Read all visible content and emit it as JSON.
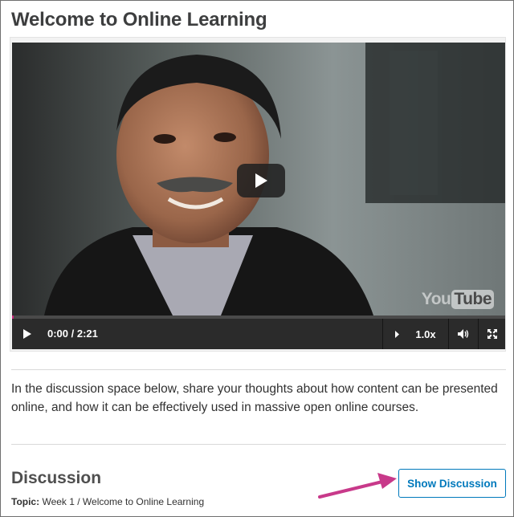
{
  "unit": {
    "title": "Welcome to Online Learning",
    "intro_text": "In the discussion space below, share your thoughts about how content can be presented online, and how it can be effectively used in massive open online courses."
  },
  "video": {
    "time_display": "0:00 / 2:21",
    "speed": "1.0x",
    "progress_fraction": 0.0,
    "brand": "YouTube",
    "icons": {
      "play_overlay": "play-icon",
      "play_control": "play-icon",
      "speed_caret": "caret-right-icon",
      "volume": "volume-icon",
      "fullscreen": "fullscreen-icon"
    }
  },
  "discussion": {
    "heading": "Discussion",
    "topic_label": "Topic:",
    "topic_value": "Week 1 / Welcome to Online Learning",
    "show_button": "Show Discussion"
  },
  "colors": {
    "accent_blue": "#0079bc",
    "annotation_arrow": "#c8398a",
    "progress_head": "#c8257a"
  }
}
